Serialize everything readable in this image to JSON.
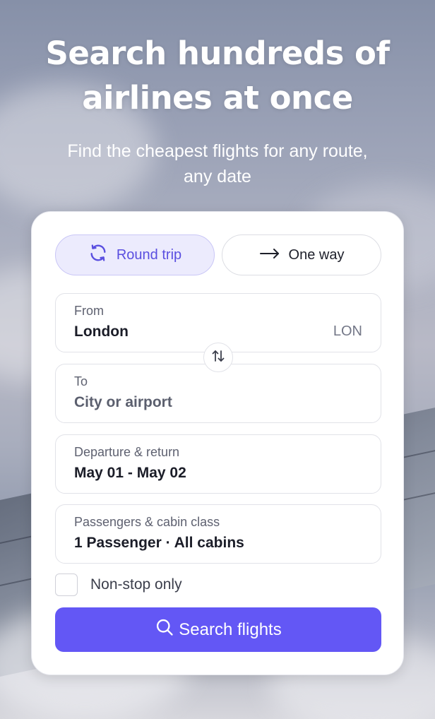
{
  "hero": {
    "title_line1": "Search hundreds of",
    "title_line2": "airlines at once",
    "subtitle_line1": "Find the cheapest flights for any route,",
    "subtitle_line2": "any date"
  },
  "trip_type": {
    "round_trip": "Round trip",
    "one_way": "One way",
    "selected": "Round trip"
  },
  "from": {
    "label": "From",
    "value": "London",
    "code": "LON"
  },
  "to": {
    "label": "To",
    "placeholder": "City or airport"
  },
  "dates": {
    "label": "Departure & return",
    "value": "May 01 - May 02"
  },
  "passengers": {
    "label": "Passengers & cabin class",
    "value": "1 Passenger · All cabins"
  },
  "nonstop": {
    "label": "Non-stop only",
    "checked": false
  },
  "search_button": {
    "label": "Search flights"
  },
  "colors": {
    "accent": "#6357f5",
    "active_toggle_bg": "#ecebfd",
    "active_toggle_text": "#5a4fe0"
  },
  "icons": {
    "round_trip": "refresh-icon",
    "one_way": "arrow-right-icon",
    "swap": "swap-vertical-icon",
    "search": "search-icon"
  }
}
